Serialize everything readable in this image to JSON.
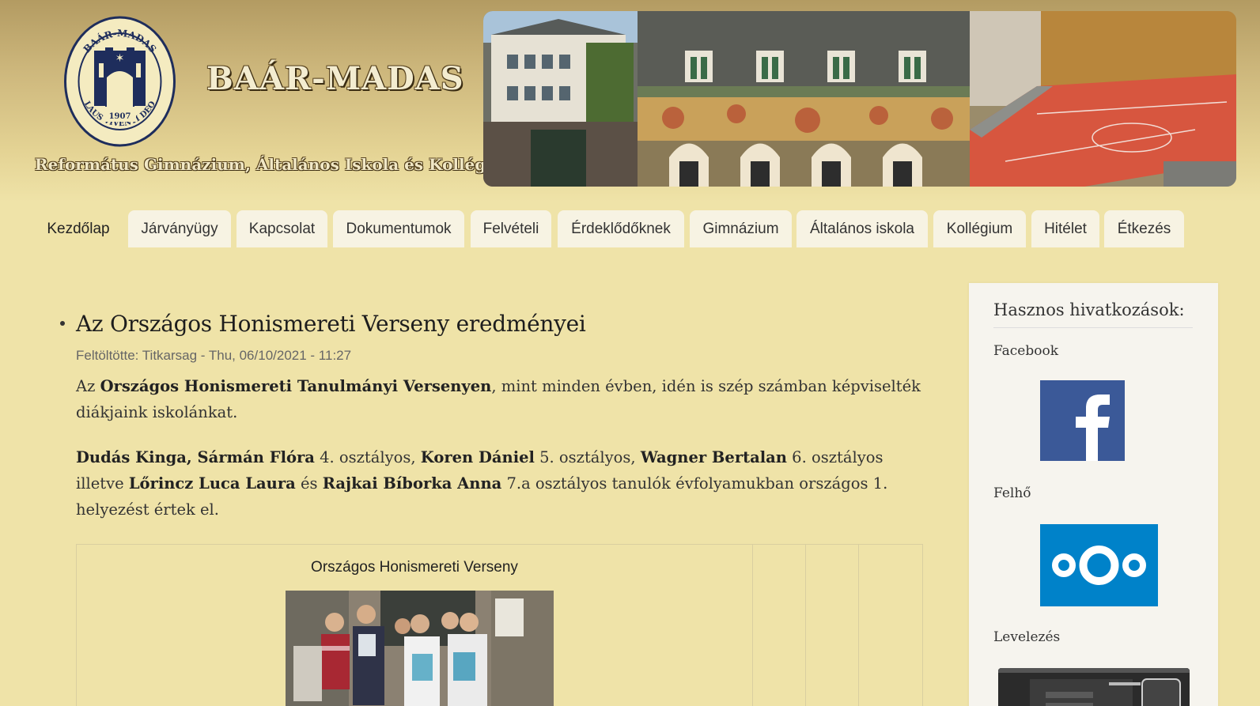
{
  "header": {
    "site_name": "BAÁR-MADAS",
    "slogan": "Református Gimnázium, Általános Iskola és Kollégium",
    "logo_text": {
      "ring_top": "BAÁR-MADAS",
      "ring_bottom": "LAUS VIVENTI DEO",
      "year": "1907"
    }
  },
  "nav": {
    "tabs": [
      {
        "label": "Kezdőlap",
        "active": true
      },
      {
        "label": "Járványügy"
      },
      {
        "label": "Kapcsolat"
      },
      {
        "label": "Dokumentumok"
      },
      {
        "label": "Felvételi"
      },
      {
        "label": "Érdeklődőknek"
      },
      {
        "label": "Gimnázium"
      },
      {
        "label": "Általános iskola"
      },
      {
        "label": "Kollégium"
      },
      {
        "label": "Hitélet"
      },
      {
        "label": "Étkezés"
      }
    ]
  },
  "article": {
    "title": "Az Országos Honismereti Verseny eredményei",
    "meta": "Feltöltötte: Titkarsag - Thu, 06/10/2021 - 11:27",
    "p1": {
      "t1": "Az ",
      "b1": "Országos Honismereti Tanulmányi Versenyen",
      "t2": ", mint minden évben, idén is szép számban képviselték diákjaink iskolánkat."
    },
    "p2": {
      "b1": "Dudás Kinga, Sármán Flóra",
      "t1": " 4. osztályos, ",
      "b2": "Koren Dániel",
      "t2": " 5. osztályos, ",
      "b3": "Wagner Bertalan",
      "t3": " 6. osztályos illetve ",
      "b4": "Lőrincz Luca Laura",
      "t4": " és ",
      "b5": "Rajkai Bíborka Anna",
      "t5": " 7.a osztályos tanulók évfolyamukban országos 1. helyezést értek el."
    },
    "table_caption": "Országos Honismereti Verseny"
  },
  "sidebar": {
    "title": "Hasznos hivatkozások:",
    "facebook_label": "Facebook",
    "cloud_label": "Felhő",
    "mail_label": "Levelezés"
  }
}
